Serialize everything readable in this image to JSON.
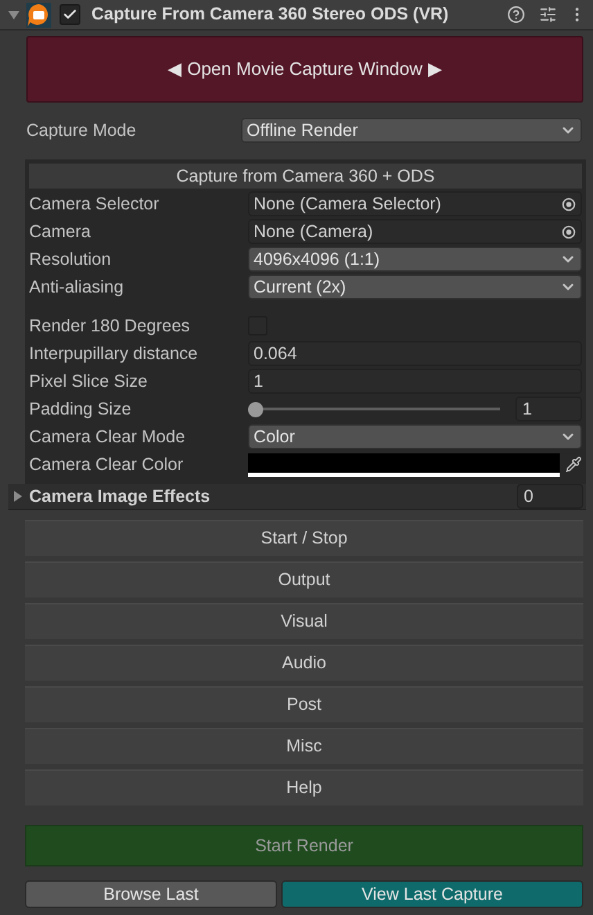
{
  "header": {
    "title": "Capture From Camera 360 Stereo ODS (VR)",
    "enabled": true,
    "expanded": true
  },
  "open_window_button": {
    "arrow_left": "◀",
    "label": "Open Movie Capture Window",
    "arrow_right": "▶"
  },
  "capture_mode": {
    "label": "Capture Mode",
    "value": "Offline Render"
  },
  "panel": {
    "title": "Capture from Camera 360 + ODS",
    "fields": [
      {
        "kind": "object",
        "label": "Camera Selector",
        "value": "None (Camera Selector)"
      },
      {
        "kind": "object",
        "label": "Camera",
        "value": "None (Camera)"
      },
      {
        "kind": "dropdown",
        "label": "Resolution",
        "value": "4096x4096 (1:1)"
      },
      {
        "kind": "dropdown",
        "label": "Anti-aliasing",
        "value": "Current (2x)"
      },
      {
        "kind": "checkbox",
        "label": "Render 180 Degrees",
        "checked": false
      },
      {
        "kind": "text",
        "label": "Interpupillary distance",
        "value": "0.064"
      },
      {
        "kind": "text",
        "label": "Pixel Slice Size",
        "value": "1"
      },
      {
        "kind": "slider",
        "label": "Padding Size",
        "level": 0,
        "value": "1"
      },
      {
        "kind": "dropdown",
        "label": "Camera Clear Mode",
        "value": "Color"
      },
      {
        "kind": "color",
        "label": "Camera Clear Color",
        "color": "#000000"
      }
    ]
  },
  "image_effects": {
    "label": "Camera Image Effects",
    "expanded": false,
    "count": "0"
  },
  "sections": [
    "Start / Stop",
    "Output",
    "Visual",
    "Audio",
    "Post",
    "Misc",
    "Help"
  ],
  "start_render_button": "Start Render",
  "browse_last_button": "Browse Last",
  "view_last_capture_button": "View Last Capture"
}
